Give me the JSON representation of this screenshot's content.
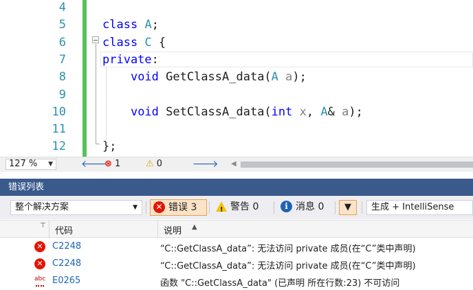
{
  "editor": {
    "line_numbers": [
      "4",
      "5",
      "6",
      "7",
      "8",
      "9",
      "10",
      "11",
      "12"
    ],
    "lines": [
      [],
      [
        {
          "t": "class",
          "c": "kw"
        },
        {
          "t": " ",
          "c": "tx"
        },
        {
          "t": "A",
          "c": "ty"
        },
        {
          "t": ";",
          "c": "tx"
        }
      ],
      [
        {
          "t": "class",
          "c": "kw"
        },
        {
          "t": " ",
          "c": "tx"
        },
        {
          "t": "C",
          "c": "ty"
        },
        {
          "t": " {",
          "c": "tx"
        }
      ],
      [
        {
          "t": "private",
          "c": "kw"
        },
        {
          "t": ":",
          "c": "tx"
        }
      ],
      [
        {
          "t": "    ",
          "c": "tx"
        },
        {
          "t": "void",
          "c": "kw"
        },
        {
          "t": " GetClassA_data(",
          "c": "tx"
        },
        {
          "t": "A",
          "c": "ty"
        },
        {
          "t": " ",
          "c": "tx"
        },
        {
          "t": "a",
          "c": "pm"
        },
        {
          "t": ");",
          "c": "tx"
        }
      ],
      [],
      [
        {
          "t": "    ",
          "c": "tx"
        },
        {
          "t": "void",
          "c": "kw"
        },
        {
          "t": " SetClassA_data(",
          "c": "tx"
        },
        {
          "t": "int",
          "c": "kw"
        },
        {
          "t": " ",
          "c": "tx"
        },
        {
          "t": "x",
          "c": "pm"
        },
        {
          "t": ", ",
          "c": "tx"
        },
        {
          "t": "A",
          "c": "ty"
        },
        {
          "t": "& ",
          "c": "tx"
        },
        {
          "t": "a",
          "c": "pm"
        },
        {
          "t": ");",
          "c": "tx"
        }
      ],
      [],
      [
        {
          "t": "};",
          "c": "tx"
        }
      ]
    ]
  },
  "status": {
    "zoom": "127 %",
    "errors": "1",
    "warnings": "0"
  },
  "panel": {
    "title": "错误列表",
    "scope": "整个解决方案",
    "errors_label": "错误 3",
    "warnings_label": "警告 0",
    "messages_label": "消息 0",
    "build_filter": "生成 + IntelliSense",
    "col_code": "代码",
    "col_desc": "说明"
  },
  "rows": [
    {
      "icon": "error-icon",
      "code": "C2248",
      "desc": "“C::GetClassA_data”: 无法访问 private 成员(在“C”类中声明)"
    },
    {
      "icon": "error-icon",
      "code": "C2248",
      "desc": "“C::GetClassA_data”: 无法访问 private 成员(在“C”类中声明)"
    },
    {
      "icon": "intellisense-error-icon",
      "code": "E0265",
      "desc": "函数 \"C::GetClassA_data\" (已声明 所在行数:23) 不可访问"
    }
  ],
  "colors": {
    "accent": "#3a5a8c",
    "error": "#e51400",
    "changebar": "#57c25a"
  }
}
